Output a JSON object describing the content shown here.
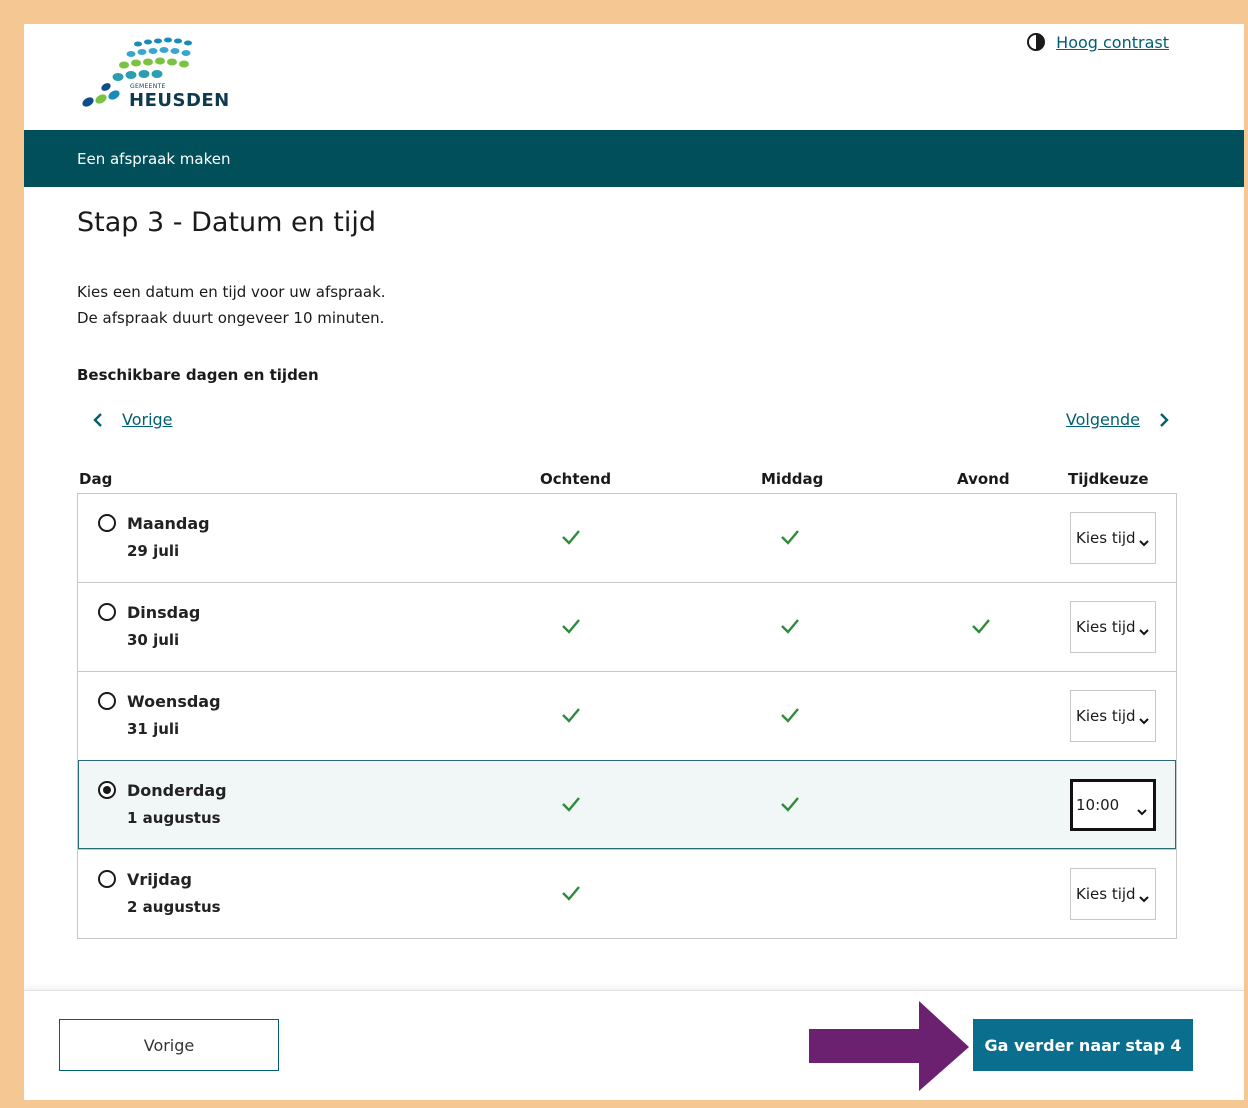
{
  "header": {
    "logo_name": "HEUSDEN",
    "logo_prefix": "GEMEENTE",
    "contrast_label": "Hoog contrast",
    "band_title": "Een afspraak maken"
  },
  "page": {
    "title": "Stap 3 - Datum en tijd",
    "intro_line1": "Kies een datum en tijd voor uw afspraak.",
    "intro_line2": "De afspraak duurt ongeveer 10 minuten.",
    "section_label": "Beschikbare dagen en tijden",
    "nav_prev": "Vorige",
    "nav_next": "Volgende"
  },
  "table": {
    "headers": {
      "dag": "Dag",
      "ochtend": "Ochtend",
      "middag": "Middag",
      "avond": "Avond",
      "tijdkeuze": "Tijdkeuze"
    },
    "rows": [
      {
        "day": "Maandag",
        "date": "29 juli",
        "ochtend": true,
        "middag": true,
        "avond": false,
        "selected": false,
        "time": "Kies tijd"
      },
      {
        "day": "Dinsdag",
        "date": "30 juli",
        "ochtend": true,
        "middag": true,
        "avond": true,
        "selected": false,
        "time": "Kies tijd"
      },
      {
        "day": "Woensdag",
        "date": "31 juli",
        "ochtend": true,
        "middag": true,
        "avond": false,
        "selected": false,
        "time": "Kies tijd"
      },
      {
        "day": "Donderdag",
        "date": "1 augustus",
        "ochtend": true,
        "middag": true,
        "avond": false,
        "selected": true,
        "time": "10:00"
      },
      {
        "day": "Vrijdag",
        "date": "2 augustus",
        "ochtend": true,
        "middag": false,
        "avond": false,
        "selected": false,
        "time": "Kies tijd"
      }
    ]
  },
  "footer": {
    "back_label": "Vorige",
    "next_label": "Ga verder naar stap 4"
  },
  "colors": {
    "band": "#004f5a",
    "link": "#005f73",
    "check": "#2e8b3a",
    "primary_button": "#0a6f8e",
    "annotation_arrow": "#6b2170",
    "frame": "#f5c792"
  },
  "icons": [
    "half-circle-contrast-icon",
    "chevron-left-icon",
    "chevron-right-icon",
    "check-icon",
    "chevron-down-icon",
    "arrow-right-icon"
  ]
}
